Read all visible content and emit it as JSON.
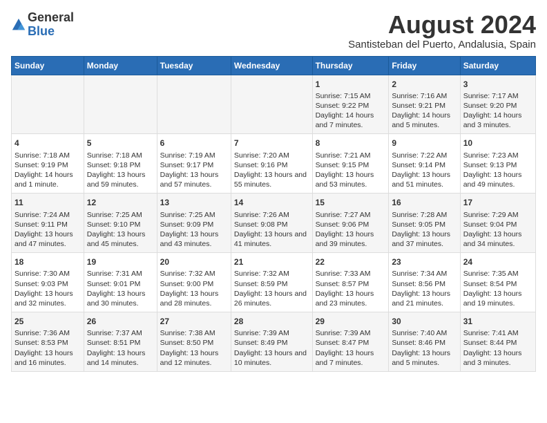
{
  "header": {
    "logo_general": "General",
    "logo_blue": "Blue",
    "title": "August 2024",
    "subtitle": "Santisteban del Puerto, Andalusia, Spain"
  },
  "calendar": {
    "headers": [
      "Sunday",
      "Monday",
      "Tuesday",
      "Wednesday",
      "Thursday",
      "Friday",
      "Saturday"
    ],
    "weeks": [
      [
        {
          "day": "",
          "content": ""
        },
        {
          "day": "",
          "content": ""
        },
        {
          "day": "",
          "content": ""
        },
        {
          "day": "",
          "content": ""
        },
        {
          "day": "1",
          "content": "Sunrise: 7:15 AM\nSunset: 9:22 PM\nDaylight: 14 hours and 7 minutes."
        },
        {
          "day": "2",
          "content": "Sunrise: 7:16 AM\nSunset: 9:21 PM\nDaylight: 14 hours and 5 minutes."
        },
        {
          "day": "3",
          "content": "Sunrise: 7:17 AM\nSunset: 9:20 PM\nDaylight: 14 hours and 3 minutes."
        }
      ],
      [
        {
          "day": "4",
          "content": "Sunrise: 7:18 AM\nSunset: 9:19 PM\nDaylight: 14 hours and 1 minute."
        },
        {
          "day": "5",
          "content": "Sunrise: 7:18 AM\nSunset: 9:18 PM\nDaylight: 13 hours and 59 minutes."
        },
        {
          "day": "6",
          "content": "Sunrise: 7:19 AM\nSunset: 9:17 PM\nDaylight: 13 hours and 57 minutes."
        },
        {
          "day": "7",
          "content": "Sunrise: 7:20 AM\nSunset: 9:16 PM\nDaylight: 13 hours and 55 minutes."
        },
        {
          "day": "8",
          "content": "Sunrise: 7:21 AM\nSunset: 9:15 PM\nDaylight: 13 hours and 53 minutes."
        },
        {
          "day": "9",
          "content": "Sunrise: 7:22 AM\nSunset: 9:14 PM\nDaylight: 13 hours and 51 minutes."
        },
        {
          "day": "10",
          "content": "Sunrise: 7:23 AM\nSunset: 9:13 PM\nDaylight: 13 hours and 49 minutes."
        }
      ],
      [
        {
          "day": "11",
          "content": "Sunrise: 7:24 AM\nSunset: 9:11 PM\nDaylight: 13 hours and 47 minutes."
        },
        {
          "day": "12",
          "content": "Sunrise: 7:25 AM\nSunset: 9:10 PM\nDaylight: 13 hours and 45 minutes."
        },
        {
          "day": "13",
          "content": "Sunrise: 7:25 AM\nSunset: 9:09 PM\nDaylight: 13 hours and 43 minutes."
        },
        {
          "day": "14",
          "content": "Sunrise: 7:26 AM\nSunset: 9:08 PM\nDaylight: 13 hours and 41 minutes."
        },
        {
          "day": "15",
          "content": "Sunrise: 7:27 AM\nSunset: 9:06 PM\nDaylight: 13 hours and 39 minutes."
        },
        {
          "day": "16",
          "content": "Sunrise: 7:28 AM\nSunset: 9:05 PM\nDaylight: 13 hours and 37 minutes."
        },
        {
          "day": "17",
          "content": "Sunrise: 7:29 AM\nSunset: 9:04 PM\nDaylight: 13 hours and 34 minutes."
        }
      ],
      [
        {
          "day": "18",
          "content": "Sunrise: 7:30 AM\nSunset: 9:03 PM\nDaylight: 13 hours and 32 minutes."
        },
        {
          "day": "19",
          "content": "Sunrise: 7:31 AM\nSunset: 9:01 PM\nDaylight: 13 hours and 30 minutes."
        },
        {
          "day": "20",
          "content": "Sunrise: 7:32 AM\nSunset: 9:00 PM\nDaylight: 13 hours and 28 minutes."
        },
        {
          "day": "21",
          "content": "Sunrise: 7:32 AM\nSunset: 8:59 PM\nDaylight: 13 hours and 26 minutes."
        },
        {
          "day": "22",
          "content": "Sunrise: 7:33 AM\nSunset: 8:57 PM\nDaylight: 13 hours and 23 minutes."
        },
        {
          "day": "23",
          "content": "Sunrise: 7:34 AM\nSunset: 8:56 PM\nDaylight: 13 hours and 21 minutes."
        },
        {
          "day": "24",
          "content": "Sunrise: 7:35 AM\nSunset: 8:54 PM\nDaylight: 13 hours and 19 minutes."
        }
      ],
      [
        {
          "day": "25",
          "content": "Sunrise: 7:36 AM\nSunset: 8:53 PM\nDaylight: 13 hours and 16 minutes."
        },
        {
          "day": "26",
          "content": "Sunrise: 7:37 AM\nSunset: 8:51 PM\nDaylight: 13 hours and 14 minutes."
        },
        {
          "day": "27",
          "content": "Sunrise: 7:38 AM\nSunset: 8:50 PM\nDaylight: 13 hours and 12 minutes."
        },
        {
          "day": "28",
          "content": "Sunrise: 7:39 AM\nSunset: 8:49 PM\nDaylight: 13 hours and 10 minutes."
        },
        {
          "day": "29",
          "content": "Sunrise: 7:39 AM\nSunset: 8:47 PM\nDaylight: 13 hours and 7 minutes."
        },
        {
          "day": "30",
          "content": "Sunrise: 7:40 AM\nSunset: 8:46 PM\nDaylight: 13 hours and 5 minutes."
        },
        {
          "day": "31",
          "content": "Sunrise: 7:41 AM\nSunset: 8:44 PM\nDaylight: 13 hours and 3 minutes."
        }
      ]
    ]
  }
}
